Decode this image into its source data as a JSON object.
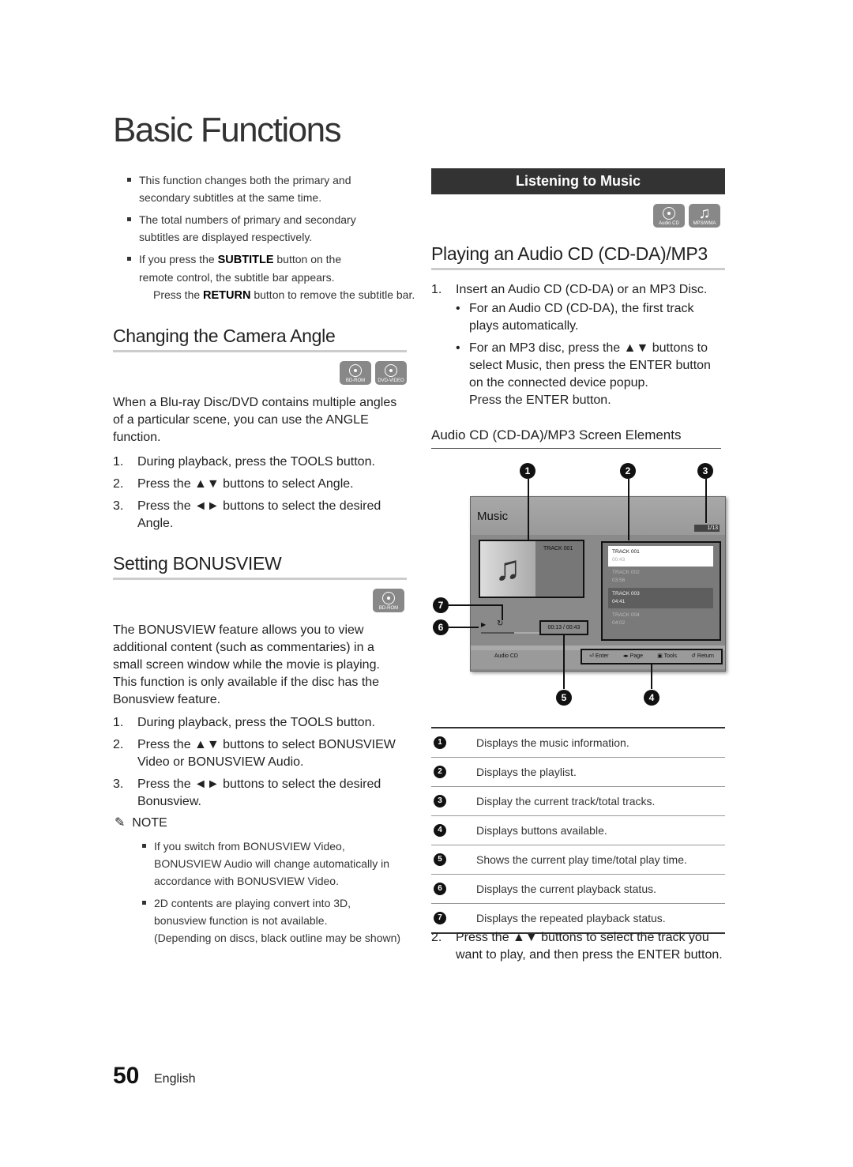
{
  "title": "Basic Functions",
  "left": {
    "subtitle_notes": [
      "This function changes both the primary and secondary subtitles at the same time.",
      "The total numbers of primary and secondary subtitles are displayed respectively.",
      {
        "a": "If you press the ",
        "k": "SUBTITLE",
        "b": " button on the remote control, the subtitle bar appears."
      }
    ],
    "return_note": {
      "a": "Press the ",
      "k": "RETURN",
      "b": " button to remove the subtitle bar."
    },
    "camera": {
      "heading": "Changing the Camera Angle",
      "icons": [
        "BD-ROM",
        "DVD-VIDEO"
      ],
      "intro": "When a Blu-ray Disc/DVD contains multiple angles of a particular scene, you can use the ANGLE function.",
      "steps": [
        {
          "n": "1.",
          "a": "During playback, press the ",
          "k": "TOOLS",
          "b": " button."
        },
        {
          "n": "2.",
          "a": "Press the ▲▼ buttons to select ",
          "k": "Angle",
          "b": "."
        },
        {
          "n": "3.",
          "a": "Press the ◄► buttons to select the desired Angle.",
          "k": "",
          "b": ""
        }
      ]
    },
    "bonus": {
      "heading": "Setting BONUSVIEW",
      "icons": [
        "BD-ROM"
      ],
      "intro": "The BONUSVIEW feature allows you to view additional content (such as commentaries) in a small screen window while the movie is playing. This function is only available if the disc has the Bonusview feature.",
      "steps": [
        {
          "n": "1.",
          "a": "During playback, press the ",
          "k": "TOOLS",
          "b": " button."
        },
        {
          "n": "2.",
          "a": "Press the ▲▼ buttons to select ",
          "k": "BONUSVIEW Video",
          "b": " or ",
          "k2": "BONUSVIEW Audio",
          "c": "."
        },
        {
          "n": "3.",
          "a": "Press the ◄► buttons to select the desired Bonusview.",
          "k": "",
          "b": ""
        }
      ],
      "note_label": "NOTE",
      "notes": [
        "If you switch from BONUSVIEW Video, BONUSVIEW Audio will change automatically in accordance with BONUSVIEW Video.",
        "2D contents are playing convert into 3D, bonusview function is not available."
      ],
      "note_sub": "(Depending on discs, black outline may be shown)"
    }
  },
  "right": {
    "banner": "Listening to Music",
    "icons": [
      "Audio CD",
      "MP3/WMA"
    ],
    "heading": "Playing an Audio CD (CD-DA)/MP3",
    "step1": "Insert an Audio CD (CD-DA) or an MP3 Disc.",
    "bullet1": "For an Audio CD (CD-DA), the first track plays automatically.",
    "bullet2": {
      "a": "For an MP3 disc, press the ▲▼ buttons to select ",
      "k": "Music",
      "b": ", then press the ",
      "k2": "ENTER",
      "c": " button on the connected device popup."
    },
    "press_enter": {
      "a": "Press the ",
      "k": "ENTER",
      "b": " button."
    },
    "sub_heading": "Audio CD (CD-DA)/MP3 Screen Elements",
    "callouts": [
      "1",
      "2",
      "3",
      "4",
      "5",
      "6",
      "7"
    ],
    "screen": {
      "title": "Music",
      "count": "1/13",
      "now_track": "TRACK 001",
      "playlist": [
        {
          "name": "TRACK 001",
          "time": "00:43"
        },
        {
          "name": "TRACK 002",
          "time": "03:56"
        },
        {
          "name": "TRACK 003",
          "time": "04:41"
        },
        {
          "name": "TRACK 004",
          "time": "04:02"
        }
      ],
      "play_time": "00:13 / 00:43",
      "source": "Audio CD",
      "buttons": [
        "Enter",
        "Page",
        "Tools",
        "Return"
      ]
    },
    "elements": [
      {
        "n": "1",
        "text": "Displays the music information."
      },
      {
        "n": "2",
        "text": "Displays the playlist."
      },
      {
        "n": "3",
        "text": "Display the current track/total tracks."
      },
      {
        "n": "4",
        "text": "Displays buttons available."
      },
      {
        "n": "5",
        "text": "Shows the current play time/total play time."
      },
      {
        "n": "6",
        "text": "Displays the current playback status."
      },
      {
        "n": "7",
        "text": "Displays the repeated playback status."
      }
    ],
    "step2": {
      "n": "2.",
      "a": "Press the ▲▼ buttons to select the track you want to play, and then press the ",
      "k": "ENTER",
      "b": " button."
    },
    "step1_n": "1."
  },
  "footer": {
    "page": "50",
    "lang": "English"
  }
}
